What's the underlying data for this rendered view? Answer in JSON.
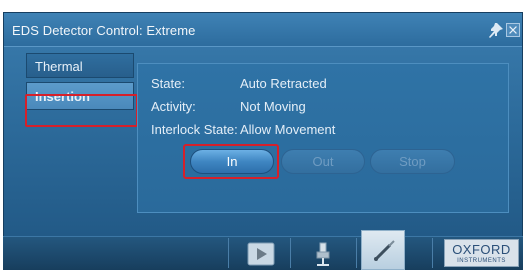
{
  "window": {
    "title": "EDS Detector Control: Extreme"
  },
  "sidebar": {
    "items": [
      {
        "label": "Thermal",
        "selected": false
      },
      {
        "label": "Insertion",
        "selected": true
      }
    ]
  },
  "status": {
    "state_label": "State:",
    "state_value": "Auto Retracted",
    "activity_label": "Activity:",
    "activity_value": "Not Moving",
    "interlock_label": "Interlock State:",
    "interlock_value": "Allow Movement"
  },
  "actions": {
    "in_label": "In",
    "out_label": "Out",
    "stop_label": "Stop"
  },
  "toolbar": {
    "icons": [
      "play-icon",
      "detector-icon",
      "probe-icon"
    ],
    "active_icon": "probe-icon"
  },
  "logo": {
    "main": "OXFORD",
    "sub": "INSTRUMENTS"
  },
  "colors": {
    "highlight": "#d6202a",
    "accent": "#3f86c2"
  }
}
